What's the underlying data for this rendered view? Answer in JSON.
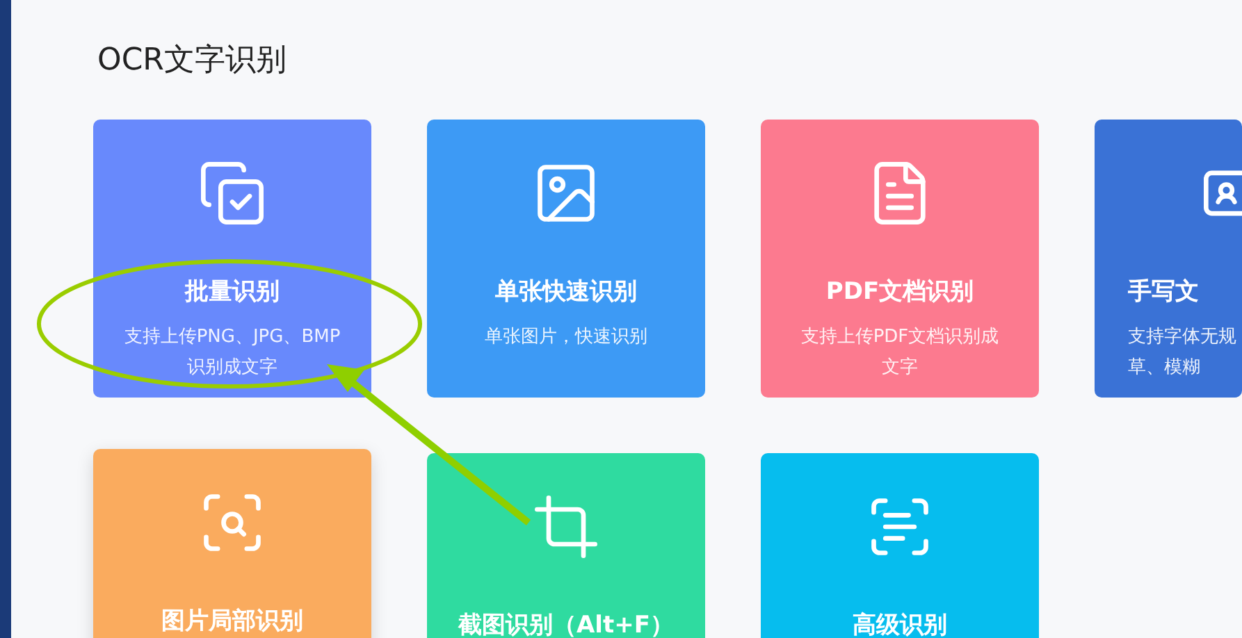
{
  "page_title": "OCR文字识别",
  "cards": [
    {
      "kind": "batch",
      "title": "批量识别",
      "description_lines": [
        "支持上传PNG、JPG、BMP",
        "识别成文字"
      ],
      "color": "#6889fc",
      "cut_off": false,
      "hovered": false
    },
    {
      "kind": "image",
      "title": "单张快速识别",
      "description_lines": [
        "单张图片，快速识别"
      ],
      "color": "#3d9af5",
      "cut_off": false,
      "hovered": false
    },
    {
      "kind": "pdf",
      "title": "PDF文档识别",
      "description_lines": [
        "支持上传PDF文档识别成",
        "文字"
      ],
      "color": "#fc7a8f",
      "cut_off": false,
      "hovered": false
    },
    {
      "kind": "handwriting",
      "title": "手写文",
      "description_lines": [
        "支持字体无规",
        "草、模糊"
      ],
      "color": "#3a72d6",
      "cut_off": true,
      "hovered": false
    },
    {
      "kind": "region",
      "title": "图片局部识别",
      "color": "#faab5e",
      "cut_off": false,
      "hovered": true
    },
    {
      "kind": "crop",
      "title": "截图识别（Alt+F）",
      "color": "#2fdba0",
      "cut_off": false,
      "hovered": false
    },
    {
      "kind": "advanced",
      "title": "高级识别",
      "color": "#06bdee",
      "cut_off": false,
      "hovered": false
    }
  ]
}
